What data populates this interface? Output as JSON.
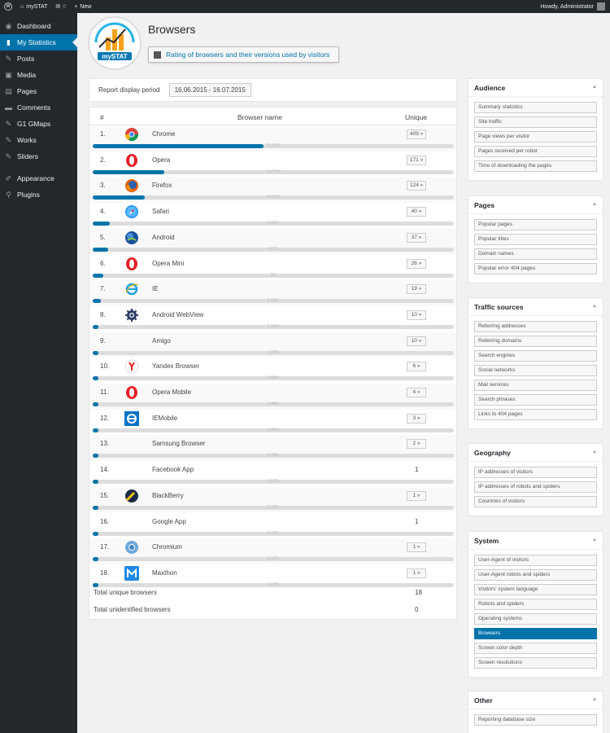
{
  "adminbar": {
    "site_name": "mySTAT",
    "comments_count": "0",
    "new_label": "New",
    "howdy": "Howdy, Administrator"
  },
  "sidebar": {
    "items": [
      {
        "label": "Dashboard",
        "icon": "dashboard-icon"
      },
      {
        "label": "My Statistics",
        "icon": "stats-icon",
        "active": true
      },
      {
        "label": "Posts",
        "icon": "pin-icon"
      },
      {
        "label": "Media",
        "icon": "media-icon"
      },
      {
        "label": "Pages",
        "icon": "pages-icon"
      },
      {
        "label": "Comments",
        "icon": "comments-icon"
      },
      {
        "label": "G1 GMaps",
        "icon": "pin-icon"
      },
      {
        "label": "Works",
        "icon": "pin-icon"
      },
      {
        "label": "Sliders",
        "icon": "pin-icon"
      },
      {
        "label": "Appearance",
        "icon": "appearance-icon"
      },
      {
        "label": "Plugins",
        "icon": "plugins-icon"
      }
    ]
  },
  "header": {
    "logo_text": "mySTAT",
    "title": "Browsers",
    "subtitle": "Rating of browsers and their versions used by visitors"
  },
  "period": {
    "label": "Report display period",
    "value": "16.06.2015 - 16.07.2015"
  },
  "table": {
    "col_num": "#",
    "col_name": "Browser name",
    "col_unique": "Unique",
    "rows": [
      {
        "num": "1.",
        "name": "Chrome",
        "unique": "409 »",
        "pct": "47.23%",
        "fill": 0.4723,
        "icon": "chrome-icon"
      },
      {
        "num": "2.",
        "name": "Opera",
        "unique": "171 »",
        "pct": "19.75%",
        "fill": 0.1975,
        "icon": "opera-icon"
      },
      {
        "num": "3.",
        "name": "Firefox",
        "unique": "124 »",
        "pct": "14.32%",
        "fill": 0.1432,
        "icon": "firefox-icon"
      },
      {
        "num": "4.",
        "name": "Safari",
        "unique": "40 »",
        "pct": "4.62%",
        "fill": 0.0462,
        "icon": "safari-icon"
      },
      {
        "num": "5.",
        "name": "Android",
        "unique": "37 »",
        "pct": "4.27%",
        "fill": 0.0427,
        "icon": "android-icon"
      },
      {
        "num": "6.",
        "name": "Opera Mini",
        "unique": "26 »",
        "pct": "3%",
        "fill": 0.03,
        "icon": "opera-icon"
      },
      {
        "num": "7.",
        "name": "IE",
        "unique": "19 »",
        "pct": "2.19%",
        "fill": 0.0219,
        "icon": "ie-icon"
      },
      {
        "num": "8.",
        "name": "Android WebView",
        "unique": "10 »",
        "pct": "1.15%",
        "fill": 0.0115,
        "icon": "gear-icon"
      },
      {
        "num": "9.",
        "name": "Amigo",
        "unique": "10 »",
        "pct": "1.15%",
        "fill": 0.0115,
        "icon": ""
      },
      {
        "num": "10.",
        "name": "Yandex Browser",
        "unique": "6 »",
        "pct": "0.69%",
        "fill": 0.0069,
        "icon": "yandex-icon"
      },
      {
        "num": "11.",
        "name": "Opera Mobile",
        "unique": "4 »",
        "pct": "0.46%",
        "fill": 0.0046,
        "icon": "opera-icon"
      },
      {
        "num": "12.",
        "name": "IEMobile",
        "unique": "3 »",
        "pct": "0.35%",
        "fill": 0.0035,
        "icon": "iemobile-icon"
      },
      {
        "num": "13.",
        "name": "Samsung Browser",
        "unique": "2 »",
        "pct": "0.23%",
        "fill": 0.0023,
        "icon": ""
      },
      {
        "num": "14.",
        "name": "Facebook App",
        "unique": "1",
        "pct": "0.12%",
        "fill": 0.0012,
        "icon": "",
        "plain": true
      },
      {
        "num": "15.",
        "name": "BlackBerry",
        "unique": "1 »",
        "pct": "0.12%",
        "fill": 0.0012,
        "icon": "blackberry-icon"
      },
      {
        "num": "16.",
        "name": "Google App",
        "unique": "1",
        "pct": "0.12%",
        "fill": 0.0012,
        "icon": "",
        "plain": true
      },
      {
        "num": "17.",
        "name": "Chromium",
        "unique": "1 »",
        "pct": "0.12%",
        "fill": 0.0012,
        "icon": "chromium-icon"
      },
      {
        "num": "18.",
        "name": "Maxthon",
        "unique": "1 »",
        "pct": "0.12%",
        "fill": 0.0012,
        "icon": "maxthon-icon"
      }
    ],
    "total_unique_label": "Total unique browsers",
    "total_unique_value": "18",
    "total_unidentified_label": "Total unidentified browsers",
    "total_unidentified_value": "0"
  },
  "panels": [
    {
      "title": "Audience",
      "items": [
        "Summary statistics",
        "Site traffic",
        "Page views per visitor",
        "Pages received per robot",
        "Time of downloading the pages"
      ]
    },
    {
      "title": "Pages",
      "items": [
        "Popular pages",
        "Popular titles",
        "Domain names",
        "Popular error 404 pages"
      ]
    },
    {
      "title": "Traffic sources",
      "items": [
        "Referring addresses",
        "Referring domains",
        "Search engines",
        "Social networks",
        "Mail services",
        "Search phrases",
        "Links to 404 pages"
      ]
    },
    {
      "title": "Geography",
      "items": [
        "IP addresses of visitors",
        "IP addresses of robots and spiders",
        "Countries of visitors"
      ]
    },
    {
      "title": "System",
      "items": [
        "User-Agent of visitors",
        "User-Agent robots and spiders",
        "Visitors' system language",
        "Robots and spiders",
        "Operating systems",
        "Browsers",
        "Screen color depth",
        "Screen resolutions"
      ],
      "active_item": "Browsers"
    },
    {
      "title": "Other",
      "items": [
        "Reporting database size"
      ]
    }
  ],
  "colors": {
    "accent": "#0073aa",
    "sidebar_bg": "#23282d",
    "bar_track": "#dddddd"
  }
}
